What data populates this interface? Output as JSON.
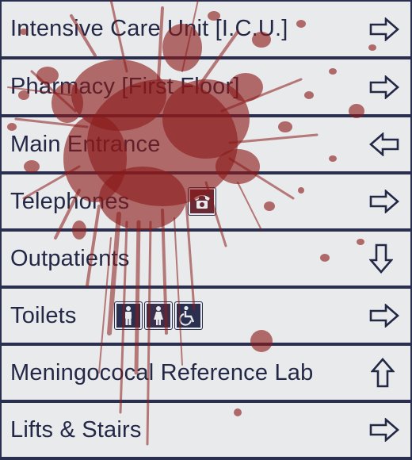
{
  "sign": {
    "rows": [
      {
        "label": "Intensive Care Unit [I.C.U.]",
        "arrow": "arrow-right"
      },
      {
        "label": "Pharmacy [First Floor]",
        "arrow": "arrow-right"
      },
      {
        "label": "Main Entrance",
        "arrow": "arrow-left"
      },
      {
        "label": "Telephones",
        "arrow": "arrow-right",
        "symbols": [
          "telephone-icon"
        ]
      },
      {
        "label": "Outpatients",
        "arrow": "arrow-down"
      },
      {
        "label": "Toilets",
        "arrow": "arrow-right",
        "symbols": [
          "male-toilet-icon",
          "female-toilet-icon",
          "wheelchair-icon"
        ]
      },
      {
        "label": "Meningococal Reference Lab",
        "arrow": "arrow-up"
      },
      {
        "label": "Lifts & Stairs",
        "arrow": "arrow-right"
      }
    ]
  },
  "colors": {
    "panel": "#e9eaeb",
    "border": "#2a2f4f",
    "text": "#232846",
    "blood": "#8b1a1a"
  }
}
